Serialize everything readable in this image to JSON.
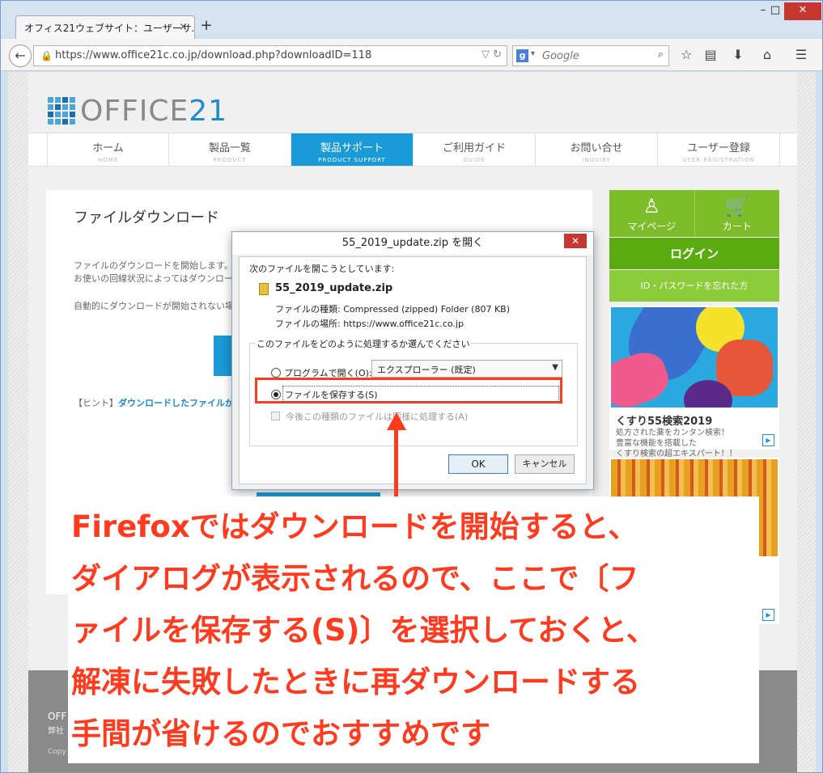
{
  "browser": {
    "tab_title": "オフィス21ウェブサイト：ユーザーサ...",
    "tab_close": "×",
    "new_tab": "+",
    "url": "https://www.office21c.co.jp/download.php?downloadID=118",
    "search_placeholder": "Google",
    "search_engine_letter": "g"
  },
  "site": {
    "logo_text": "OFFICE",
    "logo_num": "21",
    "nav": [
      {
        "jp": "ホーム",
        "en": "HOME"
      },
      {
        "jp": "製品一覧",
        "en": "PRODUCT"
      },
      {
        "jp": "製品サポート",
        "en": "PRODUCT SUPPORT"
      },
      {
        "jp": "ご利用ガイド",
        "en": "GUIDE"
      },
      {
        "jp": "お問い合せ",
        "en": "INQUIRY"
      },
      {
        "jp": "ユーザー登録",
        "en": "USER REGISTRATION"
      }
    ],
    "main": {
      "title": "ファイルダウンロード",
      "p1a": "ファイルのダウンロードを開始します。",
      "p1b": "お使いの回線状況によってはダウンロードが",
      "p2": "自動的にダウンロードが開始されない場合",
      "hint_prefix": "【ヒント】",
      "hint_link": "ダウンロードしたファイルが見つか"
    },
    "side": {
      "mypage": "マイページ",
      "cart": "カート",
      "login": "ログイン",
      "forgot": "ID・パスワードを忘れた方",
      "banner_title": "くすり55検索2019",
      "banner_d1": "処方された薬をカンタン検索！",
      "banner_d2": "豊富な機能を搭載した",
      "banner_d3": "くすり検索の超エキスパート！！"
    },
    "footer": {
      "l1": "OFF",
      "l2": "弊社",
      "l3": "Copy"
    }
  },
  "dialog": {
    "title": "55_2019_update.zip を開く",
    "close": "✕",
    "intro": "次のファイルを開こうとしています:",
    "filename": "55_2019_update.zip",
    "filetype": "ファイルの種類: Compressed (zipped) Folder (807 KB)",
    "fileloc": "ファイルの場所: https://www.office21c.co.jp",
    "group_label": "このファイルをどのように処理するか選んでください",
    "open_with": "プログラムで開く(O):",
    "open_with_value": "エクスプローラー (既定)",
    "save_file": "ファイルを保存する(S)",
    "remember": "今後この種類のファイルは同様に処理する(A)",
    "ok": "OK",
    "cancel": "キャンセル"
  },
  "annotation": {
    "lines": [
      "Firefoxではダウンロードを開始すると、",
      "ダイアログが表示されるので、ここで〔フ",
      "ァイルを保存する(S)〕を選択しておくと、",
      "解凍に失敗したときに再ダウンロードする",
      "手間が省けるのでおすすめです"
    ]
  }
}
